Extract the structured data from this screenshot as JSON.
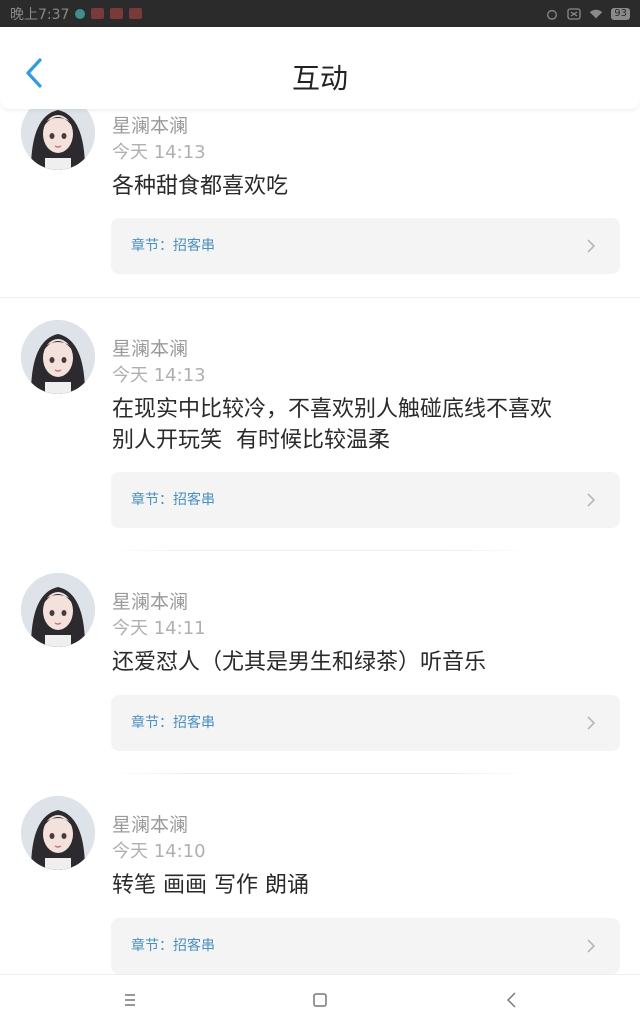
{
  "status_bar": {
    "time": "晚上7:37",
    "battery": "93"
  },
  "header": {
    "title": "互动",
    "back_icon": "chevron-left-icon"
  },
  "colors": {
    "accent": "#2f9be0",
    "chapter_link": "#4a90c2",
    "card_bg": "#f4f4f4"
  },
  "comments": [
    {
      "username": "星澜本澜",
      "time": "今天 14:13",
      "text": "各种甜食都喜欢吃",
      "chapter": "章节：招客串"
    },
    {
      "username": "星澜本澜",
      "time": "今天 14:13",
      "text_line1": "在现实中比较冷，不喜欢别人触碰底线不喜欢",
      "text_line2": "别人开玩笑  有时候比较温柔",
      "chapter": "章节：招客串"
    },
    {
      "username": "星澜本澜",
      "time": "今天 14:11",
      "text": "还爱怼人（尤其是男生和绿茶）听音乐",
      "chapter": "章节：招客串"
    },
    {
      "username": "星澜本澜",
      "time": "今天 14:10",
      "text": "转笔 画画 写作 朗诵",
      "chapter": "章节：招客串"
    }
  ],
  "navbar": {
    "menu_icon": "menu-icon",
    "home_icon": "home-square-icon",
    "back_icon": "back-triangle-icon"
  }
}
